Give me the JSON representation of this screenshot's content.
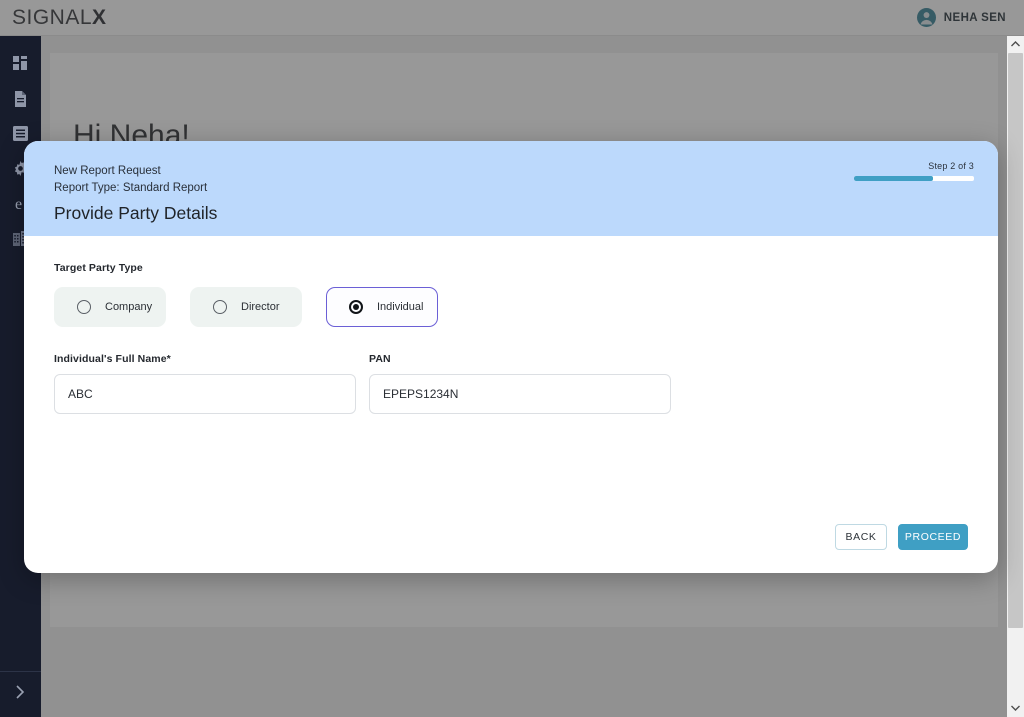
{
  "topbar": {
    "brand_main": "SIGNAL",
    "brand_accent": "X",
    "avatar_icon": "user-circle-icon",
    "user_name": "NEHA SEN"
  },
  "sidebar": {
    "items": [
      {
        "icon": "dashboard-grid-icon",
        "name": "sidebar-item-dashboard"
      },
      {
        "icon": "document-icon",
        "name": "sidebar-item-documents"
      },
      {
        "icon": "list-icon",
        "name": "sidebar-item-reports"
      },
      {
        "icon": "gear-icon",
        "name": "sidebar-item-settings"
      },
      {
        "icon": "letter-e-icon",
        "name": "sidebar-item-entity"
      },
      {
        "icon": "building-grid-icon",
        "name": "sidebar-item-companies"
      }
    ],
    "expand_icon": "chevron-right-icon"
  },
  "page": {
    "greeting": "Hi Neha!"
  },
  "modal": {
    "eyebrow": "New Report Request",
    "report_type": "Report Type: Standard Report",
    "title": "Provide Party Details",
    "step_label": "Step 2 of 3",
    "progress_percent": 66,
    "progress_color": "#3f9fc4",
    "header_color": "#bcd9fc",
    "target_party_type_label": "Target Party Type",
    "party_types": [
      {
        "label": "Company",
        "selected": false
      },
      {
        "label": "Director",
        "selected": false
      },
      {
        "label": "Individual",
        "selected": true
      }
    ],
    "selected_border_color": "#6b5fd6",
    "fields": [
      {
        "label": "Individual's Full Name*",
        "value": "ABC",
        "placeholder": ""
      },
      {
        "label": "PAN",
        "value": "EPEPS1234N",
        "placeholder": ""
      }
    ],
    "buttons": {
      "back": "BACK",
      "proceed": "PROCEED"
    }
  },
  "scrollbar": {
    "up_icon": "chevron-up-icon",
    "down_icon": "chevron-down-icon"
  }
}
